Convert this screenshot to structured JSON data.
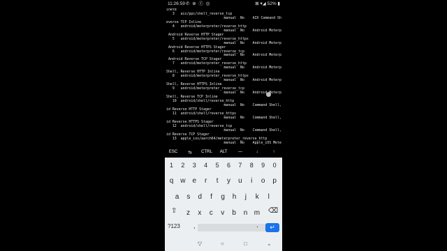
{
  "status_bar": {
    "time": "11:26:59",
    "app_icons": "✆ ⊕ ⓕ ◎",
    "right": "⊠ ▾◢ 52% ▮"
  },
  "terminal": {
    "lines": [
      "inetd                                              ",
      "   3   aix/ppc/shell_reverse_tcp",
      "                            manual  No    AIX Command Shell, R",
      "everse TCP Inline",
      "   4   android/meterpreter/reverse_http",
      "                            manual  No    Android Meterpreter,",
      " Android Reverse HTTP Stager",
      "   5   android/meterpreter/reverse_https",
      "                            manual  No    Android Meterpreter,",
      " Android Reverse HTTPS Stager",
      "   6   android/meterpreter/reverse_tcp",
      "                            manual  No    Android Meterpreter,",
      " Android Reverse TCP Stager",
      "   7   android/meterpreter_reverse_http",
      "                            manual  No    Android Meterpreter",
      "Shell, Reverse HTTP Inline",
      "   8   android/meterpreter_reverse_https",
      "                            manual  No    Android Meterpreter",
      "Shell, Reverse HTTPS Inline",
      "   9   android/meterpreter_reverse_tcp",
      "                            manual  No    Android Meterpreter",
      "Shell, Reverse TCP Inline",
      "   10  android/shell/reverse_http",
      "                            manual  No    Command Shell, Andro",
      "id Reverse HTTP Stager",
      "   11  android/shell/reverse_https",
      "                            manual  No    Command Shell, Andro",
      "id Reverse HTTPS Stager",
      "   12  android/shell/reverse_tcp",
      "                            manual  No    Command Shell, Andro",
      "id Reverse TCP Stager",
      "   13  apple_ios/aarch64/meterpreter_reverse_http",
      "                            manual  No    Apple_iOS Meterprete"
    ]
  },
  "extra_keys": [
    "ESC",
    "⇆",
    "CTRL",
    "ALT",
    "—",
    "↓",
    "↑"
  ],
  "keyboard": {
    "numbers": [
      "1",
      "2",
      "3",
      "4",
      "5",
      "6",
      "7",
      "8",
      "9",
      "0"
    ],
    "row1": [
      "q",
      "w",
      "e",
      "r",
      "t",
      "y",
      "u",
      "i",
      "o",
      "p"
    ],
    "row2": [
      "a",
      "s",
      "d",
      "f",
      "g",
      "h",
      "j",
      "k",
      "l"
    ],
    "row3": [
      "z",
      "x",
      "c",
      "v",
      "b",
      "n",
      "m"
    ],
    "shift": "⇧",
    "backspace": "⌫",
    "symbols": "?123",
    "comma": ",",
    "period": ".",
    "enter": "↵"
  },
  "nav": {
    "back": "▽",
    "home": "○",
    "recents": "□",
    "hide": "⌄"
  }
}
